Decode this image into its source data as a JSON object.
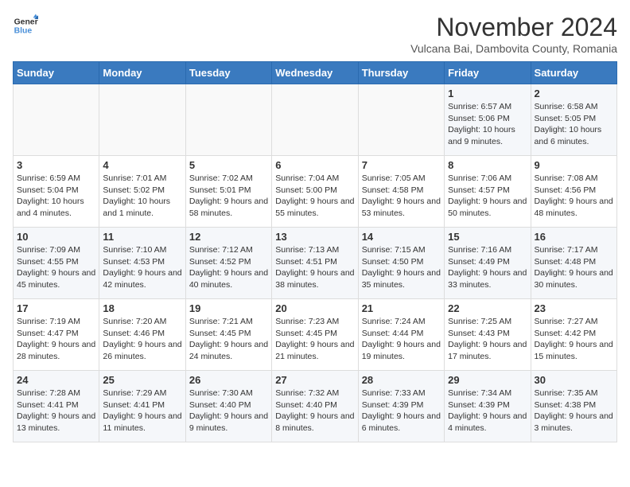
{
  "logo": {
    "line1": "General",
    "line2": "Blue"
  },
  "title": "November 2024",
  "subtitle": "Vulcana Bai, Dambovita County, Romania",
  "days_of_week": [
    "Sunday",
    "Monday",
    "Tuesday",
    "Wednesday",
    "Thursday",
    "Friday",
    "Saturday"
  ],
  "weeks": [
    [
      {
        "day": "",
        "info": ""
      },
      {
        "day": "",
        "info": ""
      },
      {
        "day": "",
        "info": ""
      },
      {
        "day": "",
        "info": ""
      },
      {
        "day": "",
        "info": ""
      },
      {
        "day": "1",
        "info": "Sunrise: 6:57 AM\nSunset: 5:06 PM\nDaylight: 10 hours and 9 minutes."
      },
      {
        "day": "2",
        "info": "Sunrise: 6:58 AM\nSunset: 5:05 PM\nDaylight: 10 hours and 6 minutes."
      }
    ],
    [
      {
        "day": "3",
        "info": "Sunrise: 6:59 AM\nSunset: 5:04 PM\nDaylight: 10 hours and 4 minutes."
      },
      {
        "day": "4",
        "info": "Sunrise: 7:01 AM\nSunset: 5:02 PM\nDaylight: 10 hours and 1 minute."
      },
      {
        "day": "5",
        "info": "Sunrise: 7:02 AM\nSunset: 5:01 PM\nDaylight: 9 hours and 58 minutes."
      },
      {
        "day": "6",
        "info": "Sunrise: 7:04 AM\nSunset: 5:00 PM\nDaylight: 9 hours and 55 minutes."
      },
      {
        "day": "7",
        "info": "Sunrise: 7:05 AM\nSunset: 4:58 PM\nDaylight: 9 hours and 53 minutes."
      },
      {
        "day": "8",
        "info": "Sunrise: 7:06 AM\nSunset: 4:57 PM\nDaylight: 9 hours and 50 minutes."
      },
      {
        "day": "9",
        "info": "Sunrise: 7:08 AM\nSunset: 4:56 PM\nDaylight: 9 hours and 48 minutes."
      }
    ],
    [
      {
        "day": "10",
        "info": "Sunrise: 7:09 AM\nSunset: 4:55 PM\nDaylight: 9 hours and 45 minutes."
      },
      {
        "day": "11",
        "info": "Sunrise: 7:10 AM\nSunset: 4:53 PM\nDaylight: 9 hours and 42 minutes."
      },
      {
        "day": "12",
        "info": "Sunrise: 7:12 AM\nSunset: 4:52 PM\nDaylight: 9 hours and 40 minutes."
      },
      {
        "day": "13",
        "info": "Sunrise: 7:13 AM\nSunset: 4:51 PM\nDaylight: 9 hours and 38 minutes."
      },
      {
        "day": "14",
        "info": "Sunrise: 7:15 AM\nSunset: 4:50 PM\nDaylight: 9 hours and 35 minutes."
      },
      {
        "day": "15",
        "info": "Sunrise: 7:16 AM\nSunset: 4:49 PM\nDaylight: 9 hours and 33 minutes."
      },
      {
        "day": "16",
        "info": "Sunrise: 7:17 AM\nSunset: 4:48 PM\nDaylight: 9 hours and 30 minutes."
      }
    ],
    [
      {
        "day": "17",
        "info": "Sunrise: 7:19 AM\nSunset: 4:47 PM\nDaylight: 9 hours and 28 minutes."
      },
      {
        "day": "18",
        "info": "Sunrise: 7:20 AM\nSunset: 4:46 PM\nDaylight: 9 hours and 26 minutes."
      },
      {
        "day": "19",
        "info": "Sunrise: 7:21 AM\nSunset: 4:45 PM\nDaylight: 9 hours and 24 minutes."
      },
      {
        "day": "20",
        "info": "Sunrise: 7:23 AM\nSunset: 4:45 PM\nDaylight: 9 hours and 21 minutes."
      },
      {
        "day": "21",
        "info": "Sunrise: 7:24 AM\nSunset: 4:44 PM\nDaylight: 9 hours and 19 minutes."
      },
      {
        "day": "22",
        "info": "Sunrise: 7:25 AM\nSunset: 4:43 PM\nDaylight: 9 hours and 17 minutes."
      },
      {
        "day": "23",
        "info": "Sunrise: 7:27 AM\nSunset: 4:42 PM\nDaylight: 9 hours and 15 minutes."
      }
    ],
    [
      {
        "day": "24",
        "info": "Sunrise: 7:28 AM\nSunset: 4:41 PM\nDaylight: 9 hours and 13 minutes."
      },
      {
        "day": "25",
        "info": "Sunrise: 7:29 AM\nSunset: 4:41 PM\nDaylight: 9 hours and 11 minutes."
      },
      {
        "day": "26",
        "info": "Sunrise: 7:30 AM\nSunset: 4:40 PM\nDaylight: 9 hours and 9 minutes."
      },
      {
        "day": "27",
        "info": "Sunrise: 7:32 AM\nSunset: 4:40 PM\nDaylight: 9 hours and 8 minutes."
      },
      {
        "day": "28",
        "info": "Sunrise: 7:33 AM\nSunset: 4:39 PM\nDaylight: 9 hours and 6 minutes."
      },
      {
        "day": "29",
        "info": "Sunrise: 7:34 AM\nSunset: 4:39 PM\nDaylight: 9 hours and 4 minutes."
      },
      {
        "day": "30",
        "info": "Sunrise: 7:35 AM\nSunset: 4:38 PM\nDaylight: 9 hours and 3 minutes."
      }
    ]
  ]
}
